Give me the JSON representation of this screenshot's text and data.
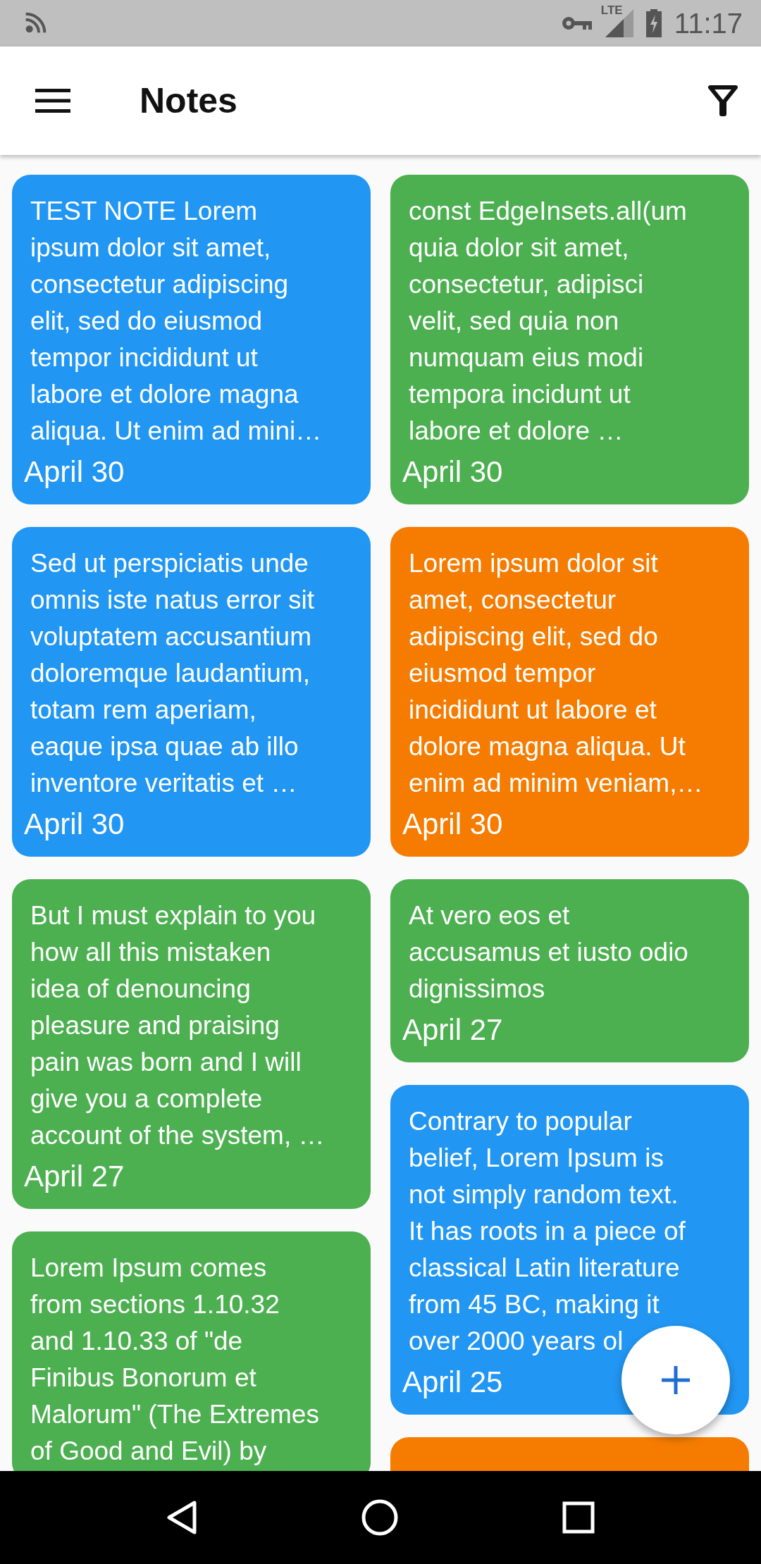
{
  "status_bar": {
    "network": "LTE",
    "time": "11:17"
  },
  "app_bar": {
    "title": "Notes"
  },
  "columns": [
    {
      "notes": [
        {
          "text": "TEST NOTE Lorem\nipsum dolor sit amet,\nconsectetur adipiscing\nelit, sed do eiusmod\ntempor incididunt ut\nlabore et dolore magna\naliqua. Ut enim ad mini…",
          "date": "April 30",
          "color": "#2196f3"
        },
        {
          "text": "Sed ut perspiciatis unde\nomnis iste natus error sit\nvoluptatem accusantium\ndoloremque laudantium,\ntotam rem aperiam,\neaque ipsa quae ab illo\ninventore veritatis et …",
          "date": "April 30",
          "color": "#2196f3"
        },
        {
          "text": "But I must explain to you\nhow all this mistaken\nidea of denouncing\npleasure and praising\npain was born and I will\ngive you a complete\naccount of the system, …",
          "date": "April 27",
          "color": "#4caf50"
        },
        {
          "text": "Lorem Ipsum comes\nfrom sections 1.10.32\nand 1.10.33 of \"de\nFinibus Bonorum et\nMalorum\" (The Extremes\nof Good and Evil) by",
          "color": "#4caf50"
        }
      ]
    },
    {
      "notes": [
        {
          "text": "const EdgeInsets.all(um\nquia dolor sit amet,\nconsectetur, adipisci\nvelit, sed quia non\nnumquam eius modi\ntempora incidunt ut\nlabore et dolore …",
          "date": "April 30",
          "color": "#4caf50"
        },
        {
          "text": "Lorem ipsum dolor sit\namet, consectetur\nadipiscing elit, sed do\neiusmod tempor\nincididunt ut labore et\ndolore magna aliqua. Ut\nenim ad minim veniam,…",
          "date": "April 30",
          "color": "#f57c00"
        },
        {
          "text": "At vero eos et\naccusamus et iusto odio\ndignissimos",
          "date": "April 27",
          "color": "#4caf50"
        },
        {
          "text": "Contrary to popular\nbelief, Lorem Ipsum is\nnot simply random text.\nIt has roots in a piece of\nclassical Latin literature\nfrom 45 BC, making it\nover 2000 years ol",
          "date": "April 25",
          "color": "#2196f3"
        },
        {
          "color": "#f57c00"
        }
      ]
    }
  ]
}
